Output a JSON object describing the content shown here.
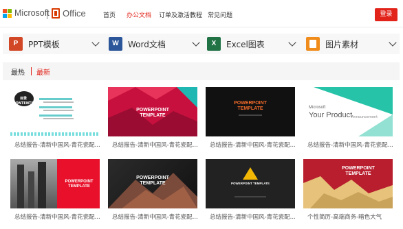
{
  "header": {
    "brand": "Microsoft",
    "product": "Office",
    "nav": [
      {
        "label": "首页",
        "active": false
      },
      {
        "label": "办公文档",
        "active": true
      },
      {
        "label": "订单及激活教程",
        "active": false
      },
      {
        "label": "常见问题",
        "active": false
      }
    ],
    "login_label": "登录"
  },
  "categories": [
    {
      "icon": "powerpoint-icon",
      "letter": "P",
      "label": "PPT模板",
      "color": "#d24726"
    },
    {
      "icon": "word-icon",
      "letter": "W",
      "label": "Word文档",
      "color": "#2b579a"
    },
    {
      "icon": "excel-icon",
      "letter": "X",
      "label": "Excel图表",
      "color": "#217346"
    },
    {
      "icon": "image-icon",
      "letter": "",
      "label": "图片素材",
      "color": "#f08c1b"
    }
  ],
  "sort": {
    "hot": "最热",
    "new": "最新"
  },
  "cards": [
    {
      "caption": "总结报告-清新中国风-青花瓷配...",
      "thumb_title": "目录\nCONTENTS"
    },
    {
      "caption": "总结报告-清新中国风-青花瓷配...",
      "thumb_title": "POWERPOINT\nTEMPLATE"
    },
    {
      "caption": "总结报告-清新中国风-青花瓷配...",
      "thumb_title": "POWERPOINT\nTEMPLATE"
    },
    {
      "caption": "总结报告-清新中国风-青花瓷配...",
      "thumb_title": "Your Product",
      "thumb_brand": "Microsoft",
      "thumb_sub": "Announcement"
    },
    {
      "caption": "总结报告-清新中国风-青花瓷配...",
      "thumb_title": "POWERPOINT\nTEMPLATE"
    },
    {
      "caption": "总结报告-清新中国风-青花瓷配...",
      "thumb_title": "POWERPOINT\nTEMPLATE"
    },
    {
      "caption": "总结报告-清新中国风-青花瓷配...",
      "thumb_title": "POWERPOINT TEMPLATE"
    },
    {
      "caption": "个性简历-高端商务-暗色大气",
      "thumb_title": "POWERPOINT\nTEMPLATE"
    }
  ]
}
